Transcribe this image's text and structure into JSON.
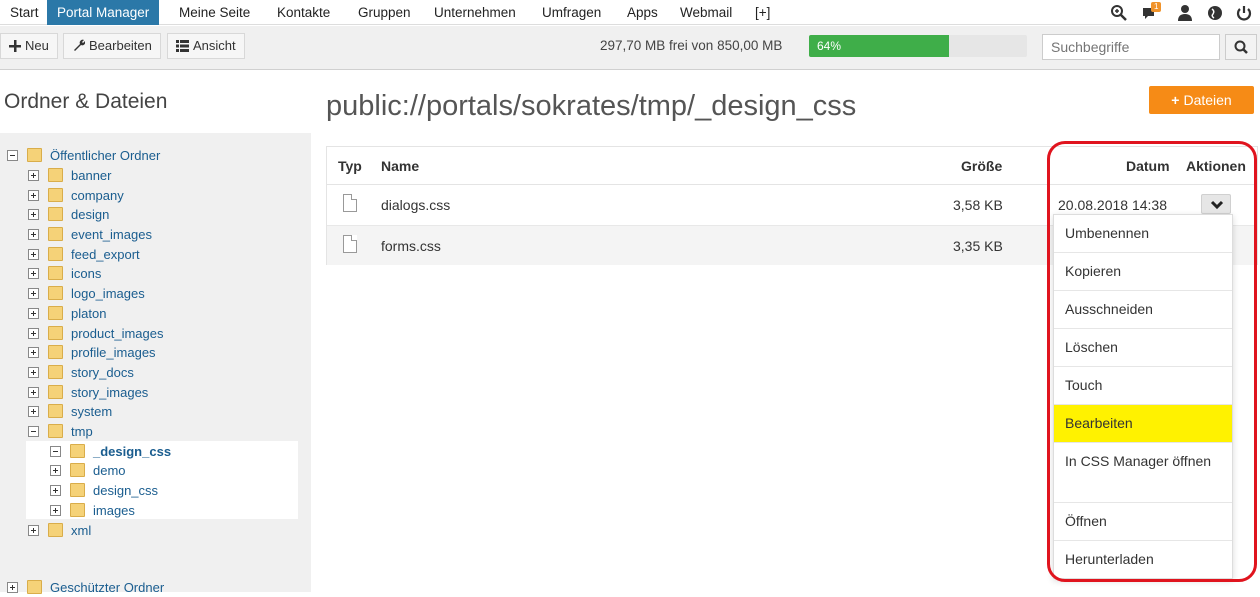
{
  "topnav": {
    "items": [
      "Start",
      "Portal Manager",
      "Meine Seite",
      "Kontakte",
      "Gruppen",
      "Unternehmen",
      "Umfragen",
      "Apps",
      "Webmail",
      "[+]"
    ],
    "active_index": 1,
    "notification_count": "1"
  },
  "toolbar": {
    "new_label": "Neu",
    "edit_label": "Bearbeiten",
    "view_label": "Ansicht",
    "quota_text": "297,70 MB frei von 850,00 MB",
    "progress_label": "64%",
    "progress_value": 0.64,
    "search_placeholder": "Suchbegriffe"
  },
  "sidebar": {
    "title": "Ordner & Dateien",
    "public_root": "Öffentlicher Ordner",
    "folders": [
      "banner",
      "company",
      "design",
      "event_images",
      "feed_export",
      "icons",
      "logo_images",
      "platon",
      "product_images",
      "profile_images",
      "story_docs",
      "story_images",
      "system",
      "tmp"
    ],
    "tmp_children": [
      "_design_css",
      "demo",
      "design_css",
      "images"
    ],
    "after_tmp": "xml",
    "protected_root": "Geschützter Ordner"
  },
  "main": {
    "path_title": "public://portals/sokrates/tmp/_design_css",
    "upload_button": "Dateien",
    "columns": {
      "type": "Typ",
      "name": "Name",
      "size": "Größe",
      "date": "Datum",
      "actions": "Aktionen"
    },
    "rows": [
      {
        "name": "dialogs.css",
        "size": "3,58 KB",
        "date": "20.08.2018 14:38"
      },
      {
        "name": "forms.css",
        "size": "3,35 KB",
        "date": ""
      }
    ]
  },
  "dropdown": {
    "items": [
      "Umbenennen",
      "Kopieren",
      "Ausschneiden",
      "Löschen",
      "Touch",
      "Bearbeiten",
      "In CSS Manager öffnen",
      "Öffnen",
      "Herunterladen"
    ],
    "highlighted_index": 5
  },
  "colors": {
    "nav_active": "#2b78a8",
    "progress": "#3fae49",
    "accent_orange": "#f68b16",
    "highlight_yellow": "#fff200",
    "annotation_red": "#e0141e"
  }
}
